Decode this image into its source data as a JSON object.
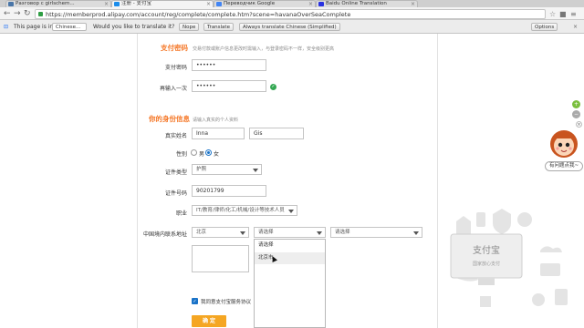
{
  "browser": {
    "tabs": [
      {
        "label": "Разговор с girlschem..."
      },
      {
        "label": "注册 - 支付宝"
      },
      {
        "label": "Переводчик Google"
      },
      {
        "label": "Baidu Online Translation"
      }
    ],
    "url": "https://memberprod.alipay.com/account/reg/complete/complete.htm?scene=havanaOverSeaComplete"
  },
  "translate_bar": {
    "prefix": "This page is in",
    "language": "Chinese...",
    "question": "Would you like to translate it?",
    "nope": "Nope",
    "translate": "Translate",
    "always": "Always translate Chinese (Simplified)",
    "options": "Options"
  },
  "form": {
    "pay_password": {
      "title": "支付密码",
      "hint": "交易付款或账户信息更改时需输入，与登录密码不一样，安全级别更高",
      "label_pwd": "支付密码",
      "value_pwd": "••••••",
      "label_confirm": "再输入一次",
      "value_confirm": "••••••"
    },
    "identity": {
      "title": "你的身份信息",
      "hint": "请输入真实的个人资料",
      "name_label": "真实姓名",
      "first_name": "Inna",
      "last_name": "Gis",
      "gender_label": "性别",
      "male": "男",
      "female": "女",
      "id_type_label": "证件类型",
      "id_type_value": "护照",
      "id_number_label": "证件号码",
      "id_number_value": "90201799",
      "job_label": "职业",
      "job_value": "IT/教育/律师/化工/机械/设计等技术人员",
      "address_label": "中国境内联系地址",
      "province_value": "北京",
      "city_value": "请选择",
      "district_value": "请选择",
      "city_options": [
        "请选择",
        "北京市"
      ]
    },
    "agreement": "我同意支付宝服务协议",
    "submit": "确 定"
  },
  "sidebar": {
    "helper_label": "有问题点我~",
    "illustration_logo": "支付宝",
    "illustration_sub": "国家放心支付"
  },
  "colors": {
    "accent": "#f5792a",
    "submit": "#f5a623",
    "link_blue": "#1a73c8",
    "ok_green": "#34a853"
  }
}
